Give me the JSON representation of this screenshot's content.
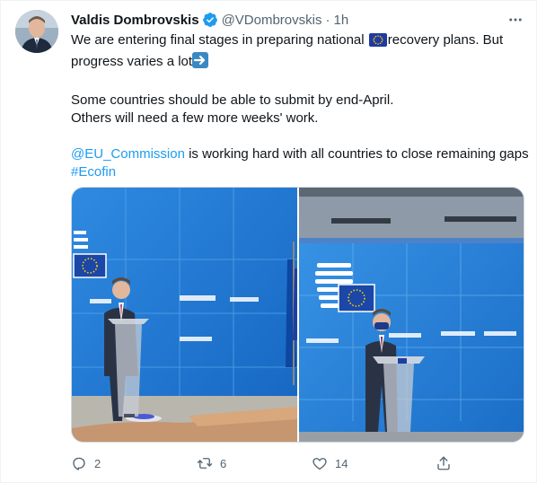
{
  "tweet": {
    "author_name": "Valdis Dombrovskis",
    "handle": "@VDombrovskis",
    "separator": "·",
    "time": "1h",
    "line1_a": "We are entering final stages in preparing national",
    "line1_b": "recovery plans. But",
    "line2": "progress varies a lot",
    "line3": "Some countries should be able to submit by end-April.",
    "line4": "Others will need a few more weeks' work.",
    "mention": "@EU_Commission",
    "line5_rest": " is working hard with all countries to close remaining gaps",
    "hashtag": "#Ecofin"
  },
  "actions": {
    "reply_count": "2",
    "retweet_count": "6",
    "like_count": "14"
  },
  "icons": {
    "verified": "verified-badge-icon",
    "more": "more-horizontal-icon",
    "reply": "reply-icon",
    "retweet": "retweet-icon",
    "like": "heart-icon",
    "share": "share-icon",
    "flag": "eu-flag-emoji",
    "arrow": "right-arrow-emoji"
  },
  "colors": {
    "link": "#1d9bf0",
    "muted": "#536471",
    "text": "#0f1419",
    "verified": "#1d9bf0"
  }
}
